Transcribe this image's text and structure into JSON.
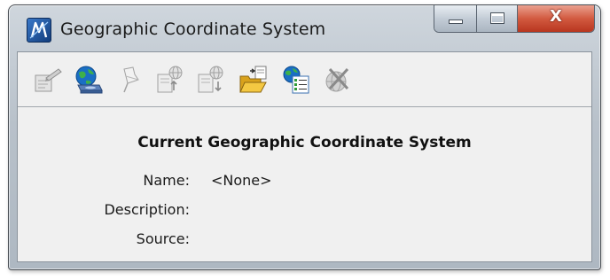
{
  "window": {
    "title": "Geographic Coordinate System",
    "app_icon": "bentley-m-icon",
    "caption": {
      "minimize_icon": "minimize-icon",
      "maximize_icon": "maximize-icon",
      "close_label": "X"
    }
  },
  "toolbar": {
    "items": [
      {
        "name": "from-design-file",
        "icon": "pencil-document-icon",
        "enabled": false
      },
      {
        "name": "from-library",
        "icon": "globe-database-icon",
        "enabled": true
      },
      {
        "name": "from-pushpin",
        "icon": "pushpin-icon",
        "enabled": false
      },
      {
        "name": "export-to-file",
        "icon": "document-globe-export-icon",
        "enabled": false
      },
      {
        "name": "import-from-file",
        "icon": "document-globe-import-icon",
        "enabled": false
      },
      {
        "name": "open-file",
        "icon": "open-folder-icon",
        "enabled": true
      },
      {
        "name": "properties",
        "icon": "globe-list-icon",
        "enabled": true
      },
      {
        "name": "delete",
        "icon": "globe-delete-icon",
        "enabled": false
      }
    ]
  },
  "content": {
    "heading": "Current Geographic Coordinate System",
    "fields": [
      {
        "label": "Name:",
        "value": "<None>"
      },
      {
        "label": "Description:",
        "value": ""
      },
      {
        "label": "Source:",
        "value": ""
      }
    ]
  },
  "colors": {
    "close_button": "#c8452a",
    "window_frame": "#b8c1ca",
    "client_bg": "#f0f0f0",
    "globe_blue": "#1a6fc4",
    "globe_green": "#2f9a3a",
    "folder_yellow": "#e8b828",
    "disabled_gray": "#a8a8a8"
  }
}
